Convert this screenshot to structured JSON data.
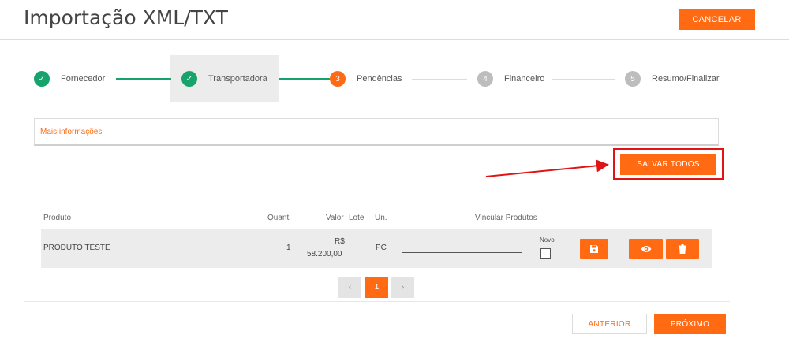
{
  "header": {
    "title": "Importação XML/TXT",
    "cancel_label": "CANCELAR"
  },
  "stepper": {
    "steps": [
      {
        "label": "Fornecedor",
        "marker": "✓",
        "state": "done"
      },
      {
        "label": "Transportadora",
        "marker": "✓",
        "state": "done"
      },
      {
        "label": "Pendências",
        "marker": "3",
        "state": "current"
      },
      {
        "label": "Financeiro",
        "marker": "4",
        "state": "todo"
      },
      {
        "label": "Resumo/Finalizar",
        "marker": "5",
        "state": "todo"
      }
    ]
  },
  "more_info": {
    "label": "Mais informações"
  },
  "actions": {
    "save_all_label": "SALVAR TODOS"
  },
  "table": {
    "headers": {
      "produto": "Produto",
      "quant": "Quant.",
      "valor": "Valor",
      "lote": "Lote",
      "un": "Un.",
      "vincular": "Vincular Produtos"
    },
    "rows": [
      {
        "produto": "PRODUTO TESTE",
        "quant": "1",
        "valor_currency": "R$",
        "valor_amount": "58.200,00",
        "un": "PC",
        "novo_label": "Novo"
      }
    ]
  },
  "pagination": {
    "prev_icon": "chevron-left-icon",
    "current_page": "1",
    "next_icon": "chevron-right-icon"
  },
  "footer": {
    "anterior_label": "ANTERIOR",
    "proximo_label": "PRÓXIMO"
  },
  "colors": {
    "accent": "#ff6a13",
    "success": "#17a36b",
    "annotation": "#e01414"
  }
}
